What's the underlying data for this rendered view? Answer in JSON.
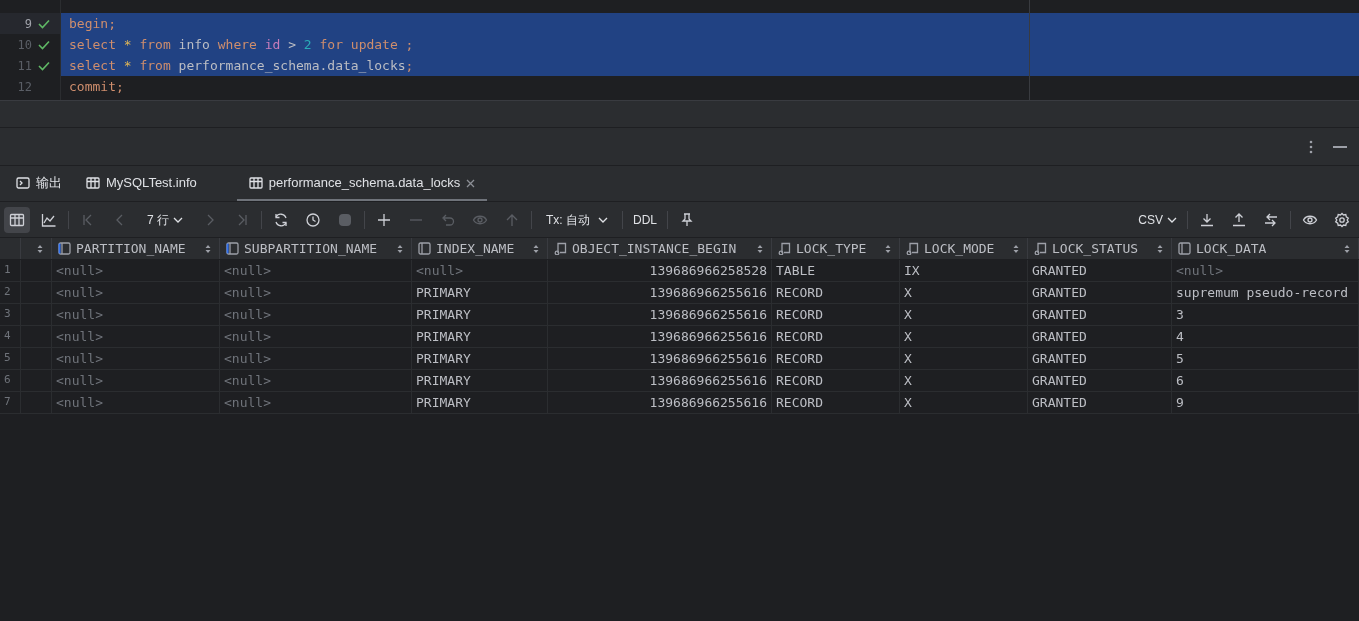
{
  "editor": {
    "lines": [
      {
        "number": "9",
        "executed": true,
        "selected": true,
        "current": true,
        "tokens": [
          {
            "kind": "keyword",
            "text": "begin"
          },
          {
            "kind": "punct",
            "text": ";"
          }
        ]
      },
      {
        "number": "10",
        "executed": true,
        "selected": true,
        "current": false,
        "tokens": [
          {
            "kind": "keyword",
            "text": "select"
          },
          {
            "kind": "star",
            "text": " * "
          },
          {
            "kind": "keyword",
            "text": "from"
          },
          {
            "kind": "ident",
            "text": " info "
          },
          {
            "kind": "keyword",
            "text": "where"
          },
          {
            "kind": "field",
            "text": " id"
          },
          {
            "kind": "ident",
            "text": " > "
          },
          {
            "kind": "number",
            "text": "2"
          },
          {
            "kind": "keyword",
            "text": " for update"
          },
          {
            "kind": "punct",
            "text": " ;"
          }
        ]
      },
      {
        "number": "11",
        "executed": true,
        "selected": true,
        "current": false,
        "tokens": [
          {
            "kind": "keyword",
            "text": "select"
          },
          {
            "kind": "star",
            "text": " * "
          },
          {
            "kind": "keyword",
            "text": "from"
          },
          {
            "kind": "ident",
            "text": " performance_schema.data_locks"
          },
          {
            "kind": "punct",
            "text": ";"
          }
        ]
      },
      {
        "number": "12",
        "executed": false,
        "selected": false,
        "current": false,
        "tokens": [
          {
            "kind": "keyword",
            "text": "commit"
          },
          {
            "kind": "punct",
            "text": ";"
          }
        ]
      }
    ]
  },
  "tabs": [
    {
      "kind": "console",
      "label": "输出",
      "selected": false,
      "closable": false
    },
    {
      "kind": "table",
      "label": "MySQLTest.info",
      "selected": false,
      "closable": false
    },
    {
      "kind": "table",
      "label": "performance_schema.data_locks",
      "selected": true,
      "closable": true
    }
  ],
  "toolbar": {
    "row_count": "7 行",
    "tx_mode": "Tx: 自动",
    "ddl": "DDL",
    "export_format": "CSV"
  },
  "table": {
    "columns": [
      {
        "label": "PARTITION_NAME",
        "kind": "marked",
        "right_aligned": false
      },
      {
        "label": "SUBPARTITION_NAME",
        "kind": "marked",
        "right_aligned": false
      },
      {
        "label": "INDEX_NAME",
        "kind": "plain",
        "right_aligned": false
      },
      {
        "label": "OBJECT_INSTANCE_BEGIN",
        "kind": "keyed",
        "right_aligned": true
      },
      {
        "label": "LOCK_TYPE",
        "kind": "keyed",
        "right_aligned": false
      },
      {
        "label": "LOCK_MODE",
        "kind": "keyed",
        "right_aligned": false
      },
      {
        "label": "LOCK_STATUS",
        "kind": "keyed",
        "right_aligned": false
      },
      {
        "label": "LOCK_DATA",
        "kind": "plain",
        "right_aligned": false
      }
    ],
    "rows": [
      {
        "number": "1",
        "cells": [
          {
            "text": "<null>",
            "null": true
          },
          {
            "text": "<null>",
            "null": true
          },
          {
            "text": "<null>",
            "null": true
          },
          {
            "text": "139686966258528",
            "null": false
          },
          {
            "text": "TABLE",
            "null": false
          },
          {
            "text": "IX",
            "null": false
          },
          {
            "text": "GRANTED",
            "null": false
          },
          {
            "text": "<null>",
            "null": true
          }
        ]
      },
      {
        "number": "2",
        "cells": [
          {
            "text": "<null>",
            "null": true
          },
          {
            "text": "<null>",
            "null": true
          },
          {
            "text": "PRIMARY",
            "null": false
          },
          {
            "text": "139686966255616",
            "null": false
          },
          {
            "text": "RECORD",
            "null": false
          },
          {
            "text": "X",
            "null": false
          },
          {
            "text": "GRANTED",
            "null": false
          },
          {
            "text": "supremum pseudo-record",
            "null": false
          }
        ]
      },
      {
        "number": "3",
        "cells": [
          {
            "text": "<null>",
            "null": true
          },
          {
            "text": "<null>",
            "null": true
          },
          {
            "text": "PRIMARY",
            "null": false
          },
          {
            "text": "139686966255616",
            "null": false
          },
          {
            "text": "RECORD",
            "null": false
          },
          {
            "text": "X",
            "null": false
          },
          {
            "text": "GRANTED",
            "null": false
          },
          {
            "text": "3",
            "null": false
          }
        ]
      },
      {
        "number": "4",
        "cells": [
          {
            "text": "<null>",
            "null": true
          },
          {
            "text": "<null>",
            "null": true
          },
          {
            "text": "PRIMARY",
            "null": false
          },
          {
            "text": "139686966255616",
            "null": false
          },
          {
            "text": "RECORD",
            "null": false
          },
          {
            "text": "X",
            "null": false
          },
          {
            "text": "GRANTED",
            "null": false
          },
          {
            "text": "4",
            "null": false
          }
        ]
      },
      {
        "number": "5",
        "cells": [
          {
            "text": "<null>",
            "null": true
          },
          {
            "text": "<null>",
            "null": true
          },
          {
            "text": "PRIMARY",
            "null": false
          },
          {
            "text": "139686966255616",
            "null": false
          },
          {
            "text": "RECORD",
            "null": false
          },
          {
            "text": "X",
            "null": false
          },
          {
            "text": "GRANTED",
            "null": false
          },
          {
            "text": "5",
            "null": false
          }
        ]
      },
      {
        "number": "6",
        "cells": [
          {
            "text": "<null>",
            "null": true
          },
          {
            "text": "<null>",
            "null": true
          },
          {
            "text": "PRIMARY",
            "null": false
          },
          {
            "text": "139686966255616",
            "null": false
          },
          {
            "text": "RECORD",
            "null": false
          },
          {
            "text": "X",
            "null": false
          },
          {
            "text": "GRANTED",
            "null": false
          },
          {
            "text": "6",
            "null": false
          }
        ]
      },
      {
        "number": "7",
        "cells": [
          {
            "text": "<null>",
            "null": true
          },
          {
            "text": "<null>",
            "null": true
          },
          {
            "text": "PRIMARY",
            "null": false
          },
          {
            "text": "139686966255616",
            "null": false
          },
          {
            "text": "RECORD",
            "null": false
          },
          {
            "text": "X",
            "null": false
          },
          {
            "text": "GRANTED",
            "null": false
          },
          {
            "text": "9",
            "null": false
          }
        ]
      }
    ]
  }
}
